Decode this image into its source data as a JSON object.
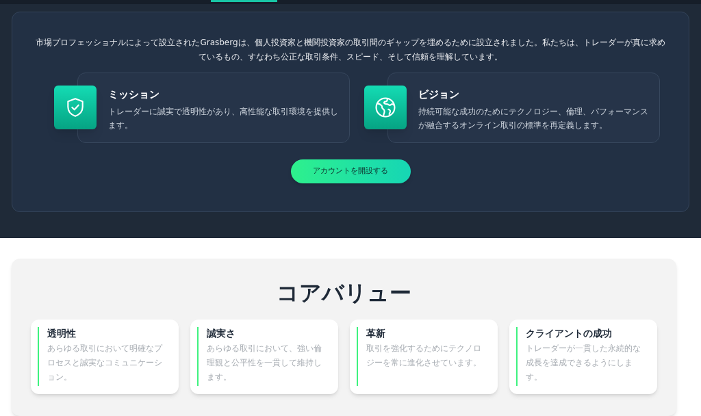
{
  "about": {
    "intro": "市場プロフェッショナルによって設立されたGrasbergは、個人投資家と機関投資家の取引間のギャップを埋めるために設立されました。私たちは、トレーダーが真に求めているもの、すなわち公正な取引条件、スピード、そして信頼を理解しています。",
    "features": [
      {
        "kind": "shield",
        "title": "ミッション",
        "text": "トレーダーに誠実で透明性があり、高性能な取引環境を提供します。"
      },
      {
        "kind": "globe",
        "title": "ビジョン",
        "text": "持続可能な成功のためにテクノロジー、倫理、パフォーマンスが融合するオンライン取引の標準を再定義します。"
      }
    ],
    "button": "アカウントを開設する"
  },
  "core_values": {
    "title": "コアバリュー",
    "items": [
      {
        "title": "透明性",
        "text": "あらゆる取引において明確なプロセスと誠実なコミュニケーション。"
      },
      {
        "title": "誠実さ",
        "text": "あらゆる取引において、強い倫理観と公平性を一貫して維持します。"
      },
      {
        "title": "革新",
        "text": "取引を強化するためにテクノロジーを常に進化させています。"
      },
      {
        "title": "クライアントの成功",
        "text": "トレーダーが一貫した永続的な成長を達成できるようにします。"
      }
    ]
  }
}
